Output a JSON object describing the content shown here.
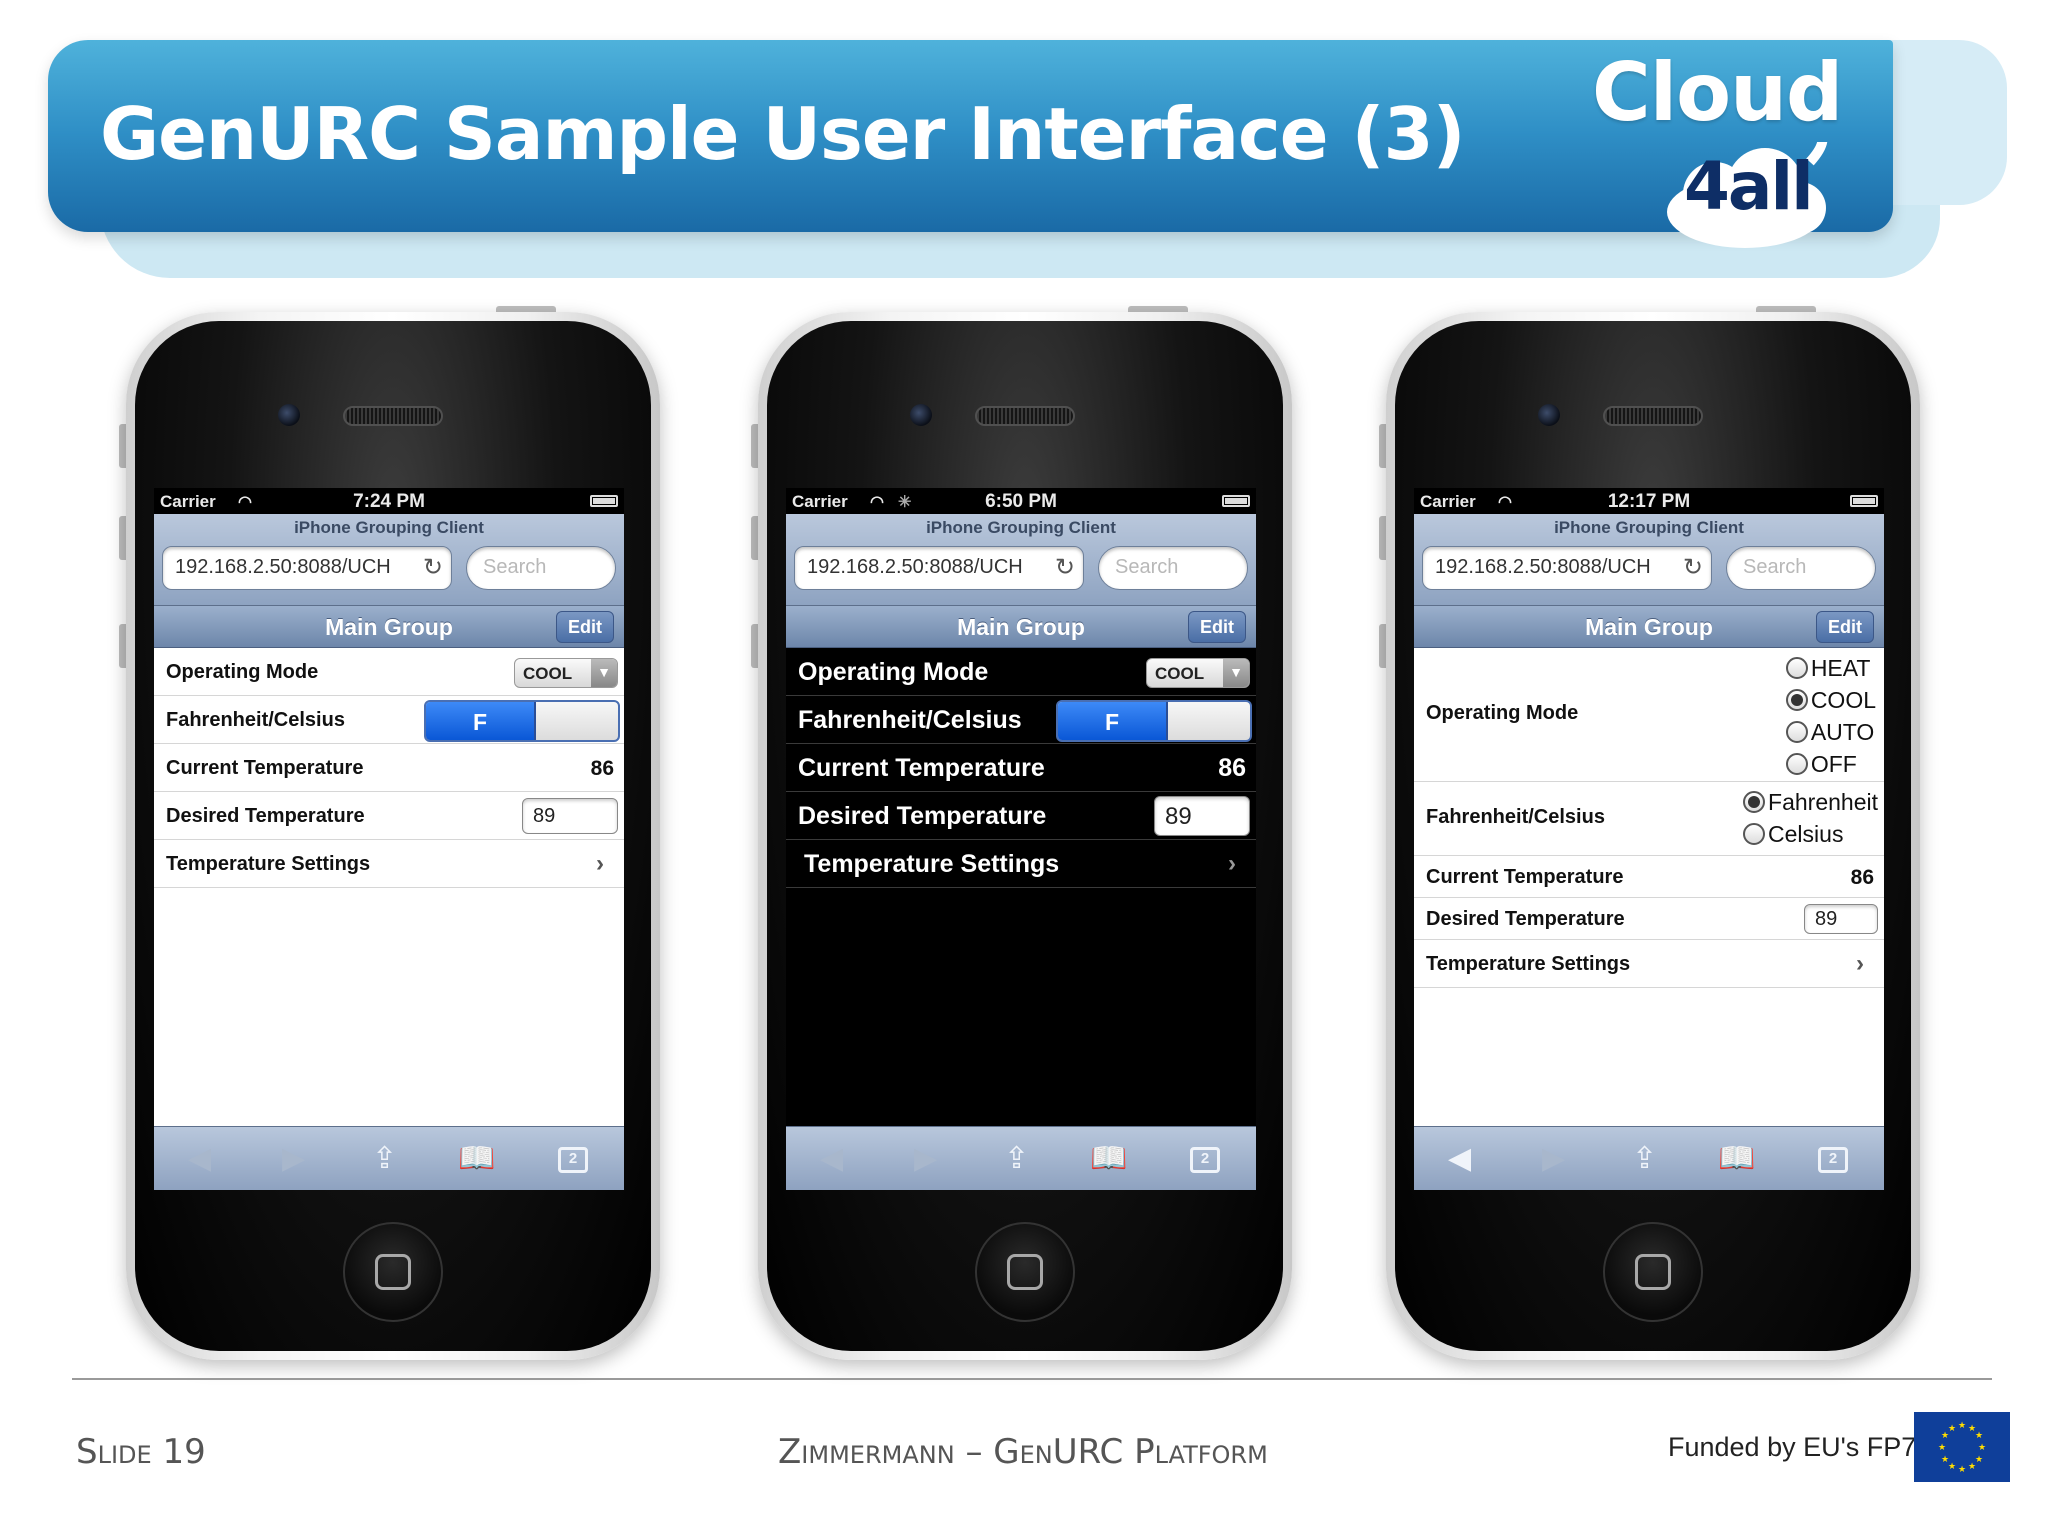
{
  "slide": {
    "title": "GenURC Sample User Interface (3)",
    "logo_word1": "Cloud",
    "logo_word2": "4all"
  },
  "phones": [
    {
      "theme": "light",
      "status": {
        "carrier": "Carrier",
        "time": "7:24 PM"
      },
      "browser": {
        "page_title": "iPhone Grouping Client",
        "url": "192.168.2.50:8088/UCH",
        "search_placeholder": "Search"
      },
      "group": {
        "title": "Main Group",
        "edit_label": "Edit"
      },
      "rows": {
        "operating_mode": {
          "label": "Operating Mode",
          "value": "COOL"
        },
        "unit": {
          "label": "Fahrenheit/Celsius",
          "value": "F"
        },
        "current_temp": {
          "label": "Current Temperature",
          "value": "86"
        },
        "desired_temp": {
          "label": "Desired Temperature",
          "value": "89"
        },
        "settings": {
          "label": "Temperature Settings"
        }
      }
    },
    {
      "theme": "dark",
      "status": {
        "carrier": "Carrier",
        "time": "6:50 PM"
      },
      "browser": {
        "page_title": "iPhone Grouping Client",
        "url": "192.168.2.50:8088/UCH",
        "search_placeholder": "Search"
      },
      "group": {
        "title": "Main Group",
        "edit_label": "Edit"
      },
      "rows": {
        "operating_mode": {
          "label": "Operating Mode",
          "value": "COOL"
        },
        "unit": {
          "label": "Fahrenheit/Celsius",
          "value": "F"
        },
        "current_temp": {
          "label": "Current Temperature",
          "value": "86"
        },
        "desired_temp": {
          "label": "Desired Temperature",
          "value": "89"
        },
        "settings": {
          "label": "Temperature Settings"
        }
      }
    },
    {
      "theme": "light",
      "status": {
        "carrier": "Carrier",
        "time": "12:17 PM"
      },
      "browser": {
        "page_title": "iPhone Grouping Client",
        "url": "192.168.2.50:8088/UCH",
        "search_placeholder": "Search"
      },
      "group": {
        "title": "Main Group",
        "edit_label": "Edit"
      },
      "rows": {
        "operating_mode": {
          "label": "Operating Mode",
          "options": [
            "HEAT",
            "COOL",
            "AUTO",
            "OFF"
          ],
          "selected": "COOL"
        },
        "unit": {
          "label": "Fahrenheit/Celsius",
          "options": [
            "Fahrenheit",
            "Celsius"
          ],
          "selected": "Fahrenheit"
        },
        "current_temp": {
          "label": "Current Temperature",
          "value": "86"
        },
        "desired_temp": {
          "label": "Desired Temperature",
          "value": "89"
        },
        "settings": {
          "label": "Temperature Settings"
        }
      }
    }
  ],
  "footer": {
    "left": "Slide 19",
    "middle": "Zimmermann – GenURC Platform",
    "right": "Funded by EU's FP7"
  },
  "colors": {
    "banner": "#2f8fc6",
    "toggle_on": "#0a57d6",
    "toolbar": "#8ea2c0",
    "eu_flag": "#0f3f9a",
    "eu_stars": "#ffdd00"
  }
}
